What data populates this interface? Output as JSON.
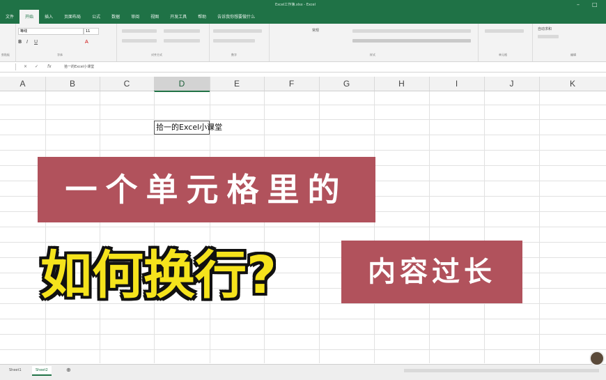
{
  "window": {
    "title": "Excel工作簿.xlsx - Excel",
    "controls": [
      "–",
      "□"
    ]
  },
  "ribbon_tabs": [
    "文件",
    "开始",
    "插入",
    "页面布局",
    "公式",
    "数据",
    "审阅",
    "视图",
    "开发工具",
    "帮助",
    "告诉我你想要做什么"
  ],
  "active_tab_index": 1,
  "ribbon": {
    "font_name": "等线",
    "font_size": "11",
    "number_format": "常规",
    "autosum_label": "自动求和",
    "group_labels": [
      "剪贴板",
      "字体",
      "对齐方式",
      "数字",
      "样式",
      "单元格",
      "编辑"
    ]
  },
  "formula_bar": {
    "cancel": "×",
    "enter": "✓",
    "fx": "fx",
    "content": "拾一的Excel小课堂"
  },
  "columns": [
    "A",
    "B",
    "C",
    "D",
    "E",
    "F",
    "G",
    "H",
    "I",
    "J",
    "K"
  ],
  "selected_column": "D",
  "cell_d3": "拾一的Excel小课堂",
  "overlay": {
    "line1": "一个单元格里的",
    "line2": "如何换行?",
    "line3": "内容过长"
  },
  "sheets": [
    "Sheet1",
    "Sheet2"
  ],
  "active_sheet_index": 1,
  "colors": {
    "excel_green": "#1f7246",
    "banner_red": "#b1525c",
    "title_yellow": "#f5e31c"
  }
}
